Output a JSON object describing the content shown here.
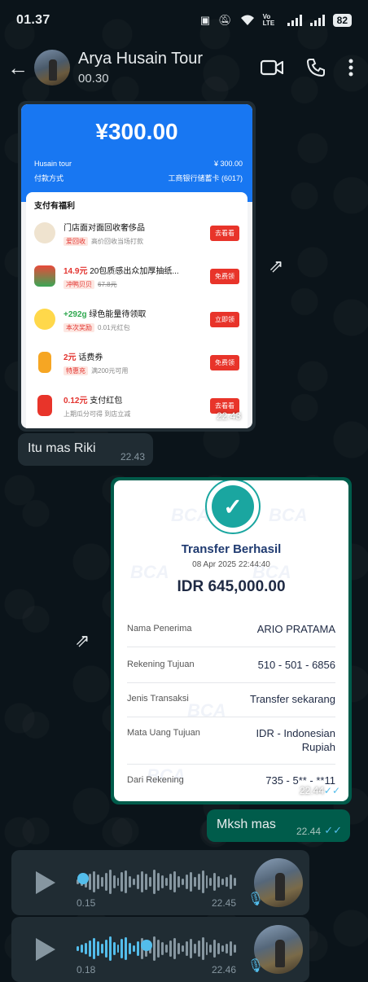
{
  "status_bar": {
    "time": "01.37",
    "network": "Vo LTE",
    "battery": "82"
  },
  "header": {
    "name": "Arya Husain Tour",
    "subtitle": "00.30"
  },
  "messages": {
    "alipay": {
      "amount": "¥300.00",
      "merchant_label": "Husain tour",
      "merchant_value": "¥ 300.00",
      "method_label": "付款方式",
      "method_value": "工商银行储蓄卡 (6017)",
      "section_title": "支付有福利",
      "items": [
        {
          "line1_hl": "",
          "line1": "门店面对面回收奢侈品",
          "tag": "爱回收",
          "line2": "高价回收当场打款",
          "button": "去看看"
        },
        {
          "line1_hl": "14.9元",
          "line1": " 20包质感出众加厚抽纸...",
          "tag": "冲鸭贝贝",
          "line2": "67.8元",
          "button": "免费领"
        },
        {
          "line1_hl": "+292g",
          "line1": " 绿色能量待领取",
          "tag": "本次奖励",
          "line2": "0.01元红包",
          "button": "立即领"
        },
        {
          "line1_hl": "2元",
          "line1": " 话费券",
          "tag": "特惠充",
          "line2": "满200元可用",
          "button": "免费领"
        },
        {
          "line1_hl": "0.12元",
          "line1": " 支付红包",
          "tag": "",
          "line2": "上期瓜分可得 到店立减",
          "button": "去看看"
        }
      ],
      "time": "22.43"
    },
    "text1": {
      "text": "Itu mas Riki",
      "time": "22.43"
    },
    "bca": {
      "title": "Transfer Berhasil",
      "datetime": "08 Apr 2025 22:44:40",
      "amount": "IDR 645,000.00",
      "watermark": "BCA",
      "rows": [
        {
          "label": "Nama Penerima",
          "value": "ARIO PRATAMA"
        },
        {
          "label": "Rekening Tujuan",
          "value": "510 - 501 - 6856"
        },
        {
          "label": "Jenis Transaksi",
          "value": "Transfer sekarang"
        },
        {
          "label": "Mata Uang Tujuan",
          "value": "IDR - Indonesian Rupiah"
        },
        {
          "label": "Dari Rekening",
          "value": "735 - 5** - **11"
        }
      ],
      "time": "22.44"
    },
    "text2": {
      "text": "Mksh mas",
      "time": "22.44"
    },
    "voice1": {
      "duration": "0.15",
      "time": "22.45",
      "progress": 0.0
    },
    "voice2": {
      "duration": "0.18",
      "time": "22.46",
      "progress": 0.4
    }
  },
  "colors": {
    "bg": "#0b141a",
    "incoming": "#202c33",
    "outgoing": "#005c4b",
    "read_ticks": "#53bdeb"
  }
}
